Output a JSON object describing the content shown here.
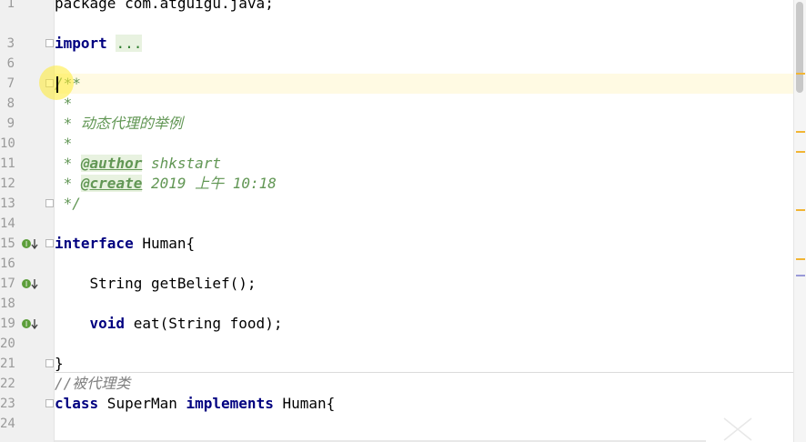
{
  "editor": {
    "lines": [
      {
        "num": "1",
        "text": "package com.atguigu.java;"
      },
      {
        "num": "3",
        "kw": "import",
        "fold": "..."
      },
      {
        "num": "6"
      },
      {
        "num": "7",
        "text": "/**"
      },
      {
        "num": "8",
        "text": " *"
      },
      {
        "num": "9",
        "text": " * 动态代理的举例"
      },
      {
        "num": "10",
        "text": " *"
      },
      {
        "num": "11",
        "tag": "@author",
        "text": " shkstart"
      },
      {
        "num": "12",
        "tag": "@create",
        "text": " 2019 上午 10:18"
      },
      {
        "num": "13",
        "text": " */"
      },
      {
        "num": "14"
      },
      {
        "num": "15",
        "kw": "interface",
        "text": " Human{"
      },
      {
        "num": "16"
      },
      {
        "num": "17",
        "text": "    String getBelief();"
      },
      {
        "num": "18"
      },
      {
        "num": "19",
        "kw": "void",
        "text": " eat(String food);"
      },
      {
        "num": "20"
      },
      {
        "num": "21",
        "text": "}"
      },
      {
        "num": "22",
        "text": "//被代理类"
      },
      {
        "num": "23",
        "kw": "class",
        "text": " SuperMan ",
        "kw2": "implements",
        "text2": " Human{"
      },
      {
        "num": "24"
      }
    ]
  },
  "colors": {
    "keyword": "#000080",
    "doc_comment": "#629755",
    "line_comment": "#808080",
    "current_line": "#fffae3",
    "gutter": "#f0f0f0",
    "marker_stripe": "#f1b534"
  },
  "icons": {
    "implementation": "implemented-method-icon",
    "fold": "fold-toggle-icon"
  }
}
